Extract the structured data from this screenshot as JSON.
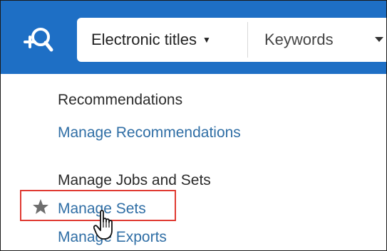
{
  "search": {
    "scope_label": "Electronic titles",
    "field_label": "Keywords",
    "icon": "persistent-search-icon"
  },
  "menu": {
    "recommendations_heading": "Recommendations",
    "manage_recommendations": "Manage Recommendations",
    "jobs_heading": "Manage Jobs and Sets",
    "manage_sets": "Manage Sets",
    "manage_exports": "Manage Exports"
  },
  "colors": {
    "topbar": "#1e6fc5",
    "link": "#2f6ea5",
    "highlight": "#e03a32"
  }
}
